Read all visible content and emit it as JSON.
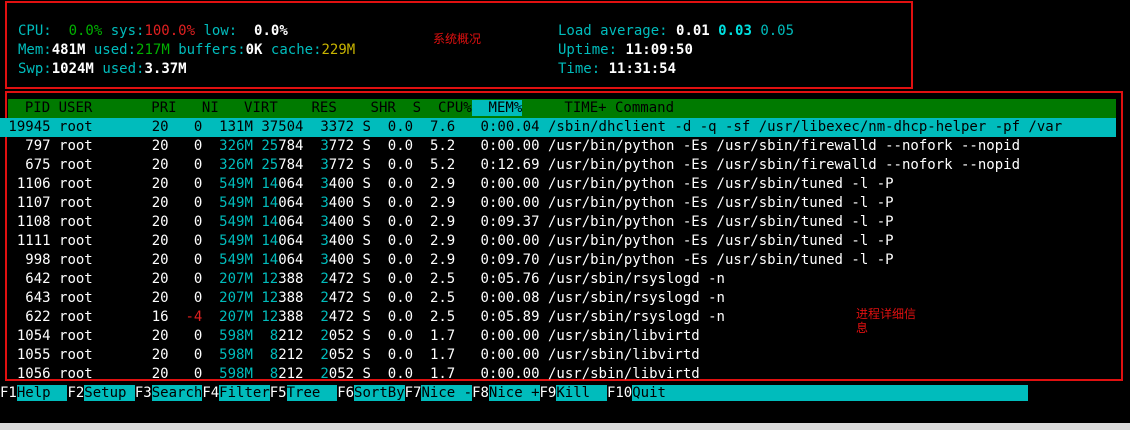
{
  "annotations": {
    "system_overview": "系统概况",
    "process_details": "进程详细信\n息"
  },
  "summary": {
    "cpu": {
      "label": "CPU:",
      "user": "0.0%",
      "sys_label": "sys:",
      "sys": "100.0%",
      "low_label": "low:",
      "low": "0.0%"
    },
    "mem": {
      "label": "Mem:",
      "total": "481M",
      "used_label": "used:",
      "used": "217M",
      "buffers_label": "buffers:",
      "buffers": "0K",
      "cache_label": "cache:",
      "cache": "229M"
    },
    "swp": {
      "label": "Swp:",
      "total": "1024M",
      "used_label": "used:",
      "used": "3.37M"
    },
    "load": {
      "label": "Load average:",
      "l1": "0.01",
      "l5": "0.03",
      "l15": "0.05"
    },
    "uptime": {
      "label": "Uptime:",
      "value": "11:09:50"
    },
    "time": {
      "label": "Time:",
      "value": "11:31:54"
    }
  },
  "columns": {
    "pid": "PID",
    "user": "USER",
    "pri": "PRI",
    "ni": "NI",
    "virt": "VIRT",
    "res": "RES",
    "shr": "SHR",
    "s": "S",
    "cpu": "CPU%",
    "mem": "MEM%",
    "time": "TIME+",
    "command": "Command"
  },
  "processes": [
    {
      "pid": "19945",
      "user": "root",
      "pri": "20",
      "ni": "0",
      "virt": "131M",
      "res": "37504",
      "shr": "3372",
      "s": "S",
      "cpu": "0.0",
      "mem": "7.6",
      "time": "0:00.04",
      "command": "/sbin/dhclient -d -q -sf /usr/libexec/nm-dhcp-helper -pf /var"
    },
    {
      "pid": "797",
      "user": "root",
      "pri": "20",
      "ni": "0",
      "virt": "326M",
      "res": "25784",
      "shr": "3772",
      "s": "S",
      "cpu": "0.0",
      "mem": "5.2",
      "time": "0:00.00",
      "command": "/usr/bin/python -Es /usr/sbin/firewalld --nofork --nopid"
    },
    {
      "pid": "675",
      "user": "root",
      "pri": "20",
      "ni": "0",
      "virt": "326M",
      "res": "25784",
      "shr": "3772",
      "s": "S",
      "cpu": "0.0",
      "mem": "5.2",
      "time": "0:12.69",
      "command": "/usr/bin/python -Es /usr/sbin/firewalld --nofork --nopid"
    },
    {
      "pid": "1106",
      "user": "root",
      "pri": "20",
      "ni": "0",
      "virt": "549M",
      "res": "14064",
      "shr": "3400",
      "s": "S",
      "cpu": "0.0",
      "mem": "2.9",
      "time": "0:00.00",
      "command": "/usr/bin/python -Es /usr/sbin/tuned -l -P"
    },
    {
      "pid": "1107",
      "user": "root",
      "pri": "20",
      "ni": "0",
      "virt": "549M",
      "res": "14064",
      "shr": "3400",
      "s": "S",
      "cpu": "0.0",
      "mem": "2.9",
      "time": "0:00.00",
      "command": "/usr/bin/python -Es /usr/sbin/tuned -l -P"
    },
    {
      "pid": "1108",
      "user": "root",
      "pri": "20",
      "ni": "0",
      "virt": "549M",
      "res": "14064",
      "shr": "3400",
      "s": "S",
      "cpu": "0.0",
      "mem": "2.9",
      "time": "0:09.37",
      "command": "/usr/bin/python -Es /usr/sbin/tuned -l -P"
    },
    {
      "pid": "1111",
      "user": "root",
      "pri": "20",
      "ni": "0",
      "virt": "549M",
      "res": "14064",
      "shr": "3400",
      "s": "S",
      "cpu": "0.0",
      "mem": "2.9",
      "time": "0:00.00",
      "command": "/usr/bin/python -Es /usr/sbin/tuned -l -P"
    },
    {
      "pid": "998",
      "user": "root",
      "pri": "20",
      "ni": "0",
      "virt": "549M",
      "res": "14064",
      "shr": "3400",
      "s": "S",
      "cpu": "0.0",
      "mem": "2.9",
      "time": "0:09.70",
      "command": "/usr/bin/python -Es /usr/sbin/tuned -l -P"
    },
    {
      "pid": "642",
      "user": "root",
      "pri": "20",
      "ni": "0",
      "virt": "207M",
      "res": "12388",
      "shr": "2472",
      "s": "S",
      "cpu": "0.0",
      "mem": "2.5",
      "time": "0:05.76",
      "command": "/usr/sbin/rsyslogd -n"
    },
    {
      "pid": "643",
      "user": "root",
      "pri": "20",
      "ni": "0",
      "virt": "207M",
      "res": "12388",
      "shr": "2472",
      "s": "S",
      "cpu": "0.0",
      "mem": "2.5",
      "time": "0:00.08",
      "command": "/usr/sbin/rsyslogd -n"
    },
    {
      "pid": "622",
      "user": "root",
      "pri": "16",
      "ni": "-4",
      "virt": "207M",
      "res": "12388",
      "shr": "2472",
      "s": "S",
      "cpu": "0.0",
      "mem": "2.5",
      "time": "0:05.89",
      "command": "/usr/sbin/rsyslogd -n"
    },
    {
      "pid": "1054",
      "user": "root",
      "pri": "20",
      "ni": "0",
      "virt": "598M",
      "res": "8212",
      "shr": "2052",
      "s": "S",
      "cpu": "0.0",
      "mem": "1.7",
      "time": "0:00.00",
      "command": "/usr/sbin/libvirtd"
    },
    {
      "pid": "1055",
      "user": "root",
      "pri": "20",
      "ni": "0",
      "virt": "598M",
      "res": "8212",
      "shr": "2052",
      "s": "S",
      "cpu": "0.0",
      "mem": "1.7",
      "time": "0:00.00",
      "command": "/usr/sbin/libvirtd"
    },
    {
      "pid": "1056",
      "user": "root",
      "pri": "20",
      "ni": "0",
      "virt": "598M",
      "res": "8212",
      "shr": "2052",
      "s": "S",
      "cpu": "0.0",
      "mem": "1.7",
      "time": "0:00.00",
      "command": "/usr/sbin/libvirtd"
    }
  ],
  "footer": [
    {
      "key": "F1",
      "label": "Help  "
    },
    {
      "key": "F2",
      "label": "Setup "
    },
    {
      "key": "F3",
      "label": "Search"
    },
    {
      "key": "F4",
      "label": "Filter"
    },
    {
      "key": "F5",
      "label": "Tree  "
    },
    {
      "key": "F6",
      "label": "SortBy"
    },
    {
      "key": "F7",
      "label": "Nice -"
    },
    {
      "key": "F8",
      "label": "Nice +"
    },
    {
      "key": "F9",
      "label": "Kill  "
    },
    {
      "key": "F10",
      "label": "Quit                                           "
    }
  ],
  "colors": {
    "accent": "#00bcbc",
    "header_bg": "#007a00",
    "annotation": "#e01010"
  }
}
